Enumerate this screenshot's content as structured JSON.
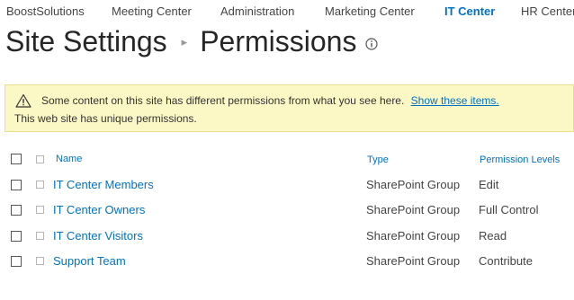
{
  "topnav": {
    "items": [
      {
        "label": "BoostSolutions"
      },
      {
        "label": "Meeting Center"
      },
      {
        "label": "Administration"
      },
      {
        "label": "Marketing Center"
      },
      {
        "label": "IT Center",
        "active": true
      },
      {
        "label": "HR Center"
      }
    ]
  },
  "title": {
    "part1": "Site Settings",
    "separator": "▸",
    "part2": "Permissions",
    "info_icon": "info-icon"
  },
  "banner": {
    "icon": "warning-icon",
    "message": "Some content on this site has different permissions from what you see here.",
    "link_label": "Show these items.",
    "unique_message": "This web site has unique permissions."
  },
  "table": {
    "headers": {
      "name": "Name",
      "type": "Type",
      "levels": "Permission Levels"
    },
    "rows": [
      {
        "name": "IT Center Members",
        "type": "SharePoint Group",
        "level": "Edit"
      },
      {
        "name": "IT Center Owners",
        "type": "SharePoint Group",
        "level": "Full Control"
      },
      {
        "name": "IT Center Visitors",
        "type": "SharePoint Group",
        "level": "Read"
      },
      {
        "name": "Support Team",
        "type": "SharePoint Group",
        "level": "Contribute"
      }
    ]
  },
  "colors": {
    "accent": "#0072c6",
    "banner_bg": "#fcf8c5",
    "text": "#444444"
  }
}
